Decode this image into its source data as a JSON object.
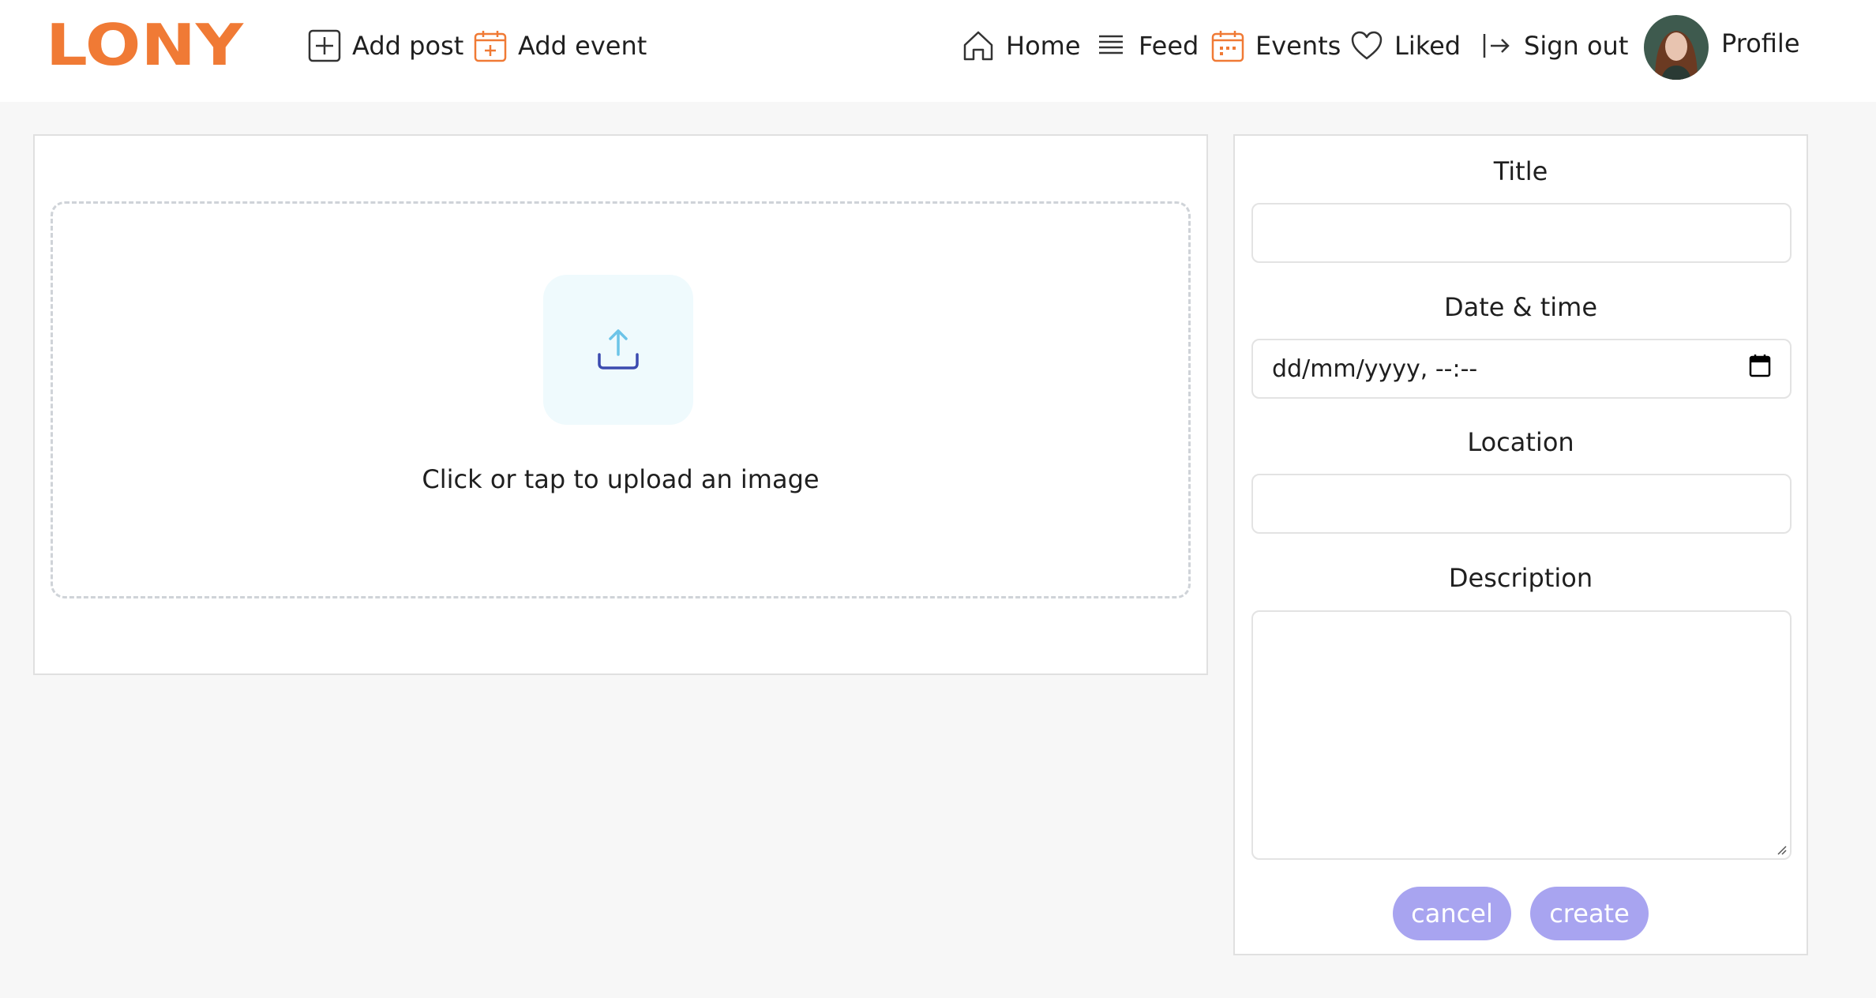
{
  "brand": {
    "logo_text": "LONY",
    "color": "#f07a35"
  },
  "header": {
    "add_post": "Add post",
    "add_event": "Add event",
    "home": "Home",
    "feed": "Feed",
    "events": "Events",
    "liked": "Liked",
    "sign_out": "Sign out",
    "profile": "Profile"
  },
  "upload": {
    "text": "Click or tap to upload an image",
    "icon": "upload-icon"
  },
  "form": {
    "title_label": "Title",
    "title_value": "",
    "datetime_label": "Date & time",
    "datetime_placeholder": "dd/mm/yyyy, --:--",
    "location_label": "Location",
    "location_value": "",
    "description_label": "Description",
    "description_value": "",
    "cancel": "cancel",
    "create": "create"
  },
  "colors": {
    "accent_orange": "#f07a35",
    "button_purple": "#a8a4f0",
    "upload_tile": "#effafd"
  }
}
